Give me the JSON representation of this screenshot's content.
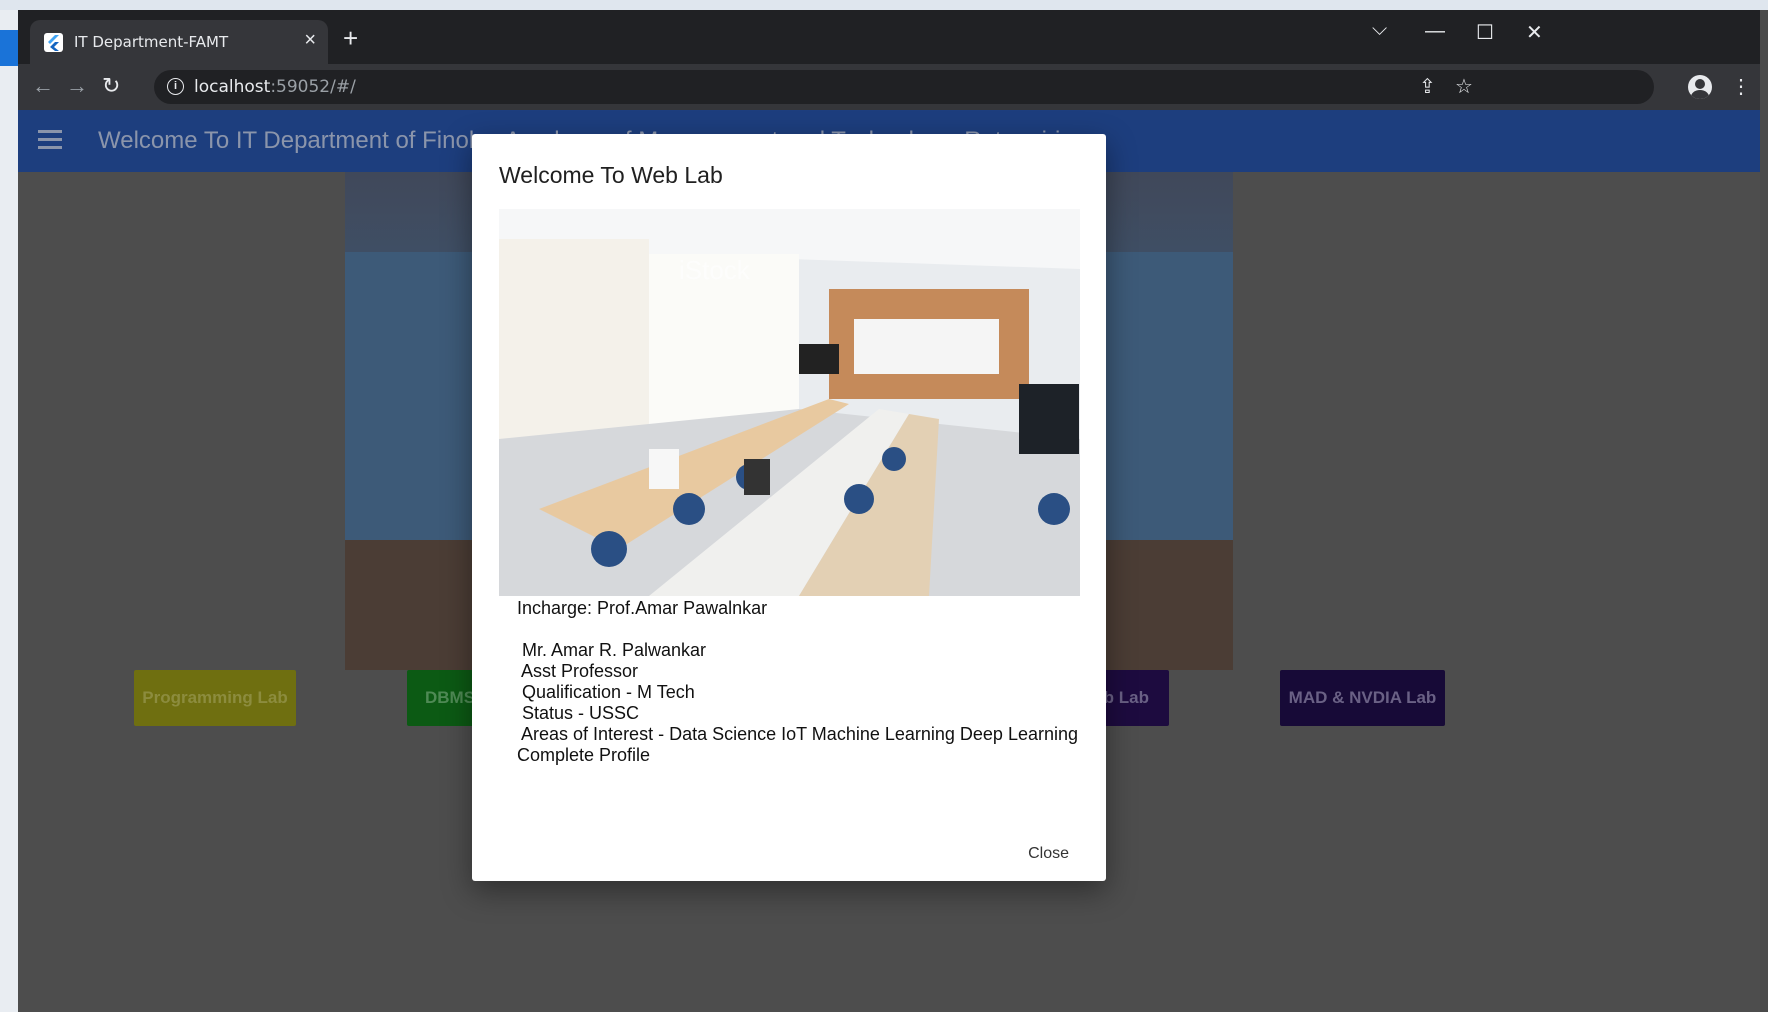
{
  "browser": {
    "tab_title": "IT Department-FAMT",
    "url_host": "localhost",
    "url_rest": ":59052/#/"
  },
  "appbar": {
    "title": "Welcome To IT Department of Finolex Academy of Management and Technology, Ratnagiri"
  },
  "lab_buttons": [
    {
      "label": "Programming Lab",
      "color": "#6f6f10"
    },
    {
      "label": "DBMS",
      "color": "#0c5a14"
    },
    {
      "label": "eb Lab",
      "color": "#1d0b3f"
    },
    {
      "label": "MAD & NVDIA Lab",
      "color": "#170a37"
    }
  ],
  "dialog": {
    "title": "Welcome To Web Lab",
    "photo_watermark": "iStock",
    "lines": [
      "Incharge: Prof.Amar Pawalnkar",
      "",
      " Mr. Amar R. Palwankar",
      " Asst Professor",
      " Qualification - M Tech",
      " Status - USSC",
      " Areas of Interest - Data Science IoT Machine Learning Deep Learning",
      "Complete Profile"
    ],
    "close_label": "Close"
  },
  "colors": {
    "appbar": "#1d3e7e",
    "overlay": "#4d4d4d"
  }
}
